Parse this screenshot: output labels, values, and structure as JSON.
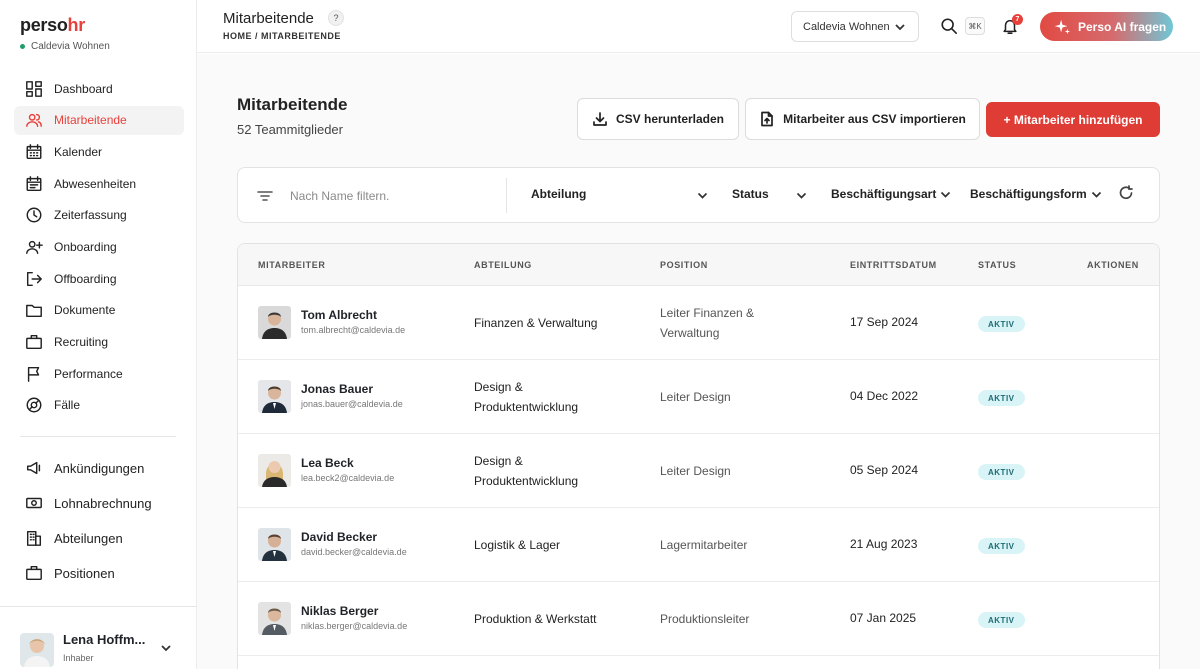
{
  "brand": {
    "name_part1": "perso",
    "name_part2": "hr",
    "company": "Caldevia Wohnen"
  },
  "sidebar": {
    "items": [
      {
        "label": "Dashboard",
        "icon": "dashboard-icon"
      },
      {
        "label": "Mitarbeitende",
        "icon": "users-icon",
        "active": true
      },
      {
        "label": "Kalender",
        "icon": "calendar-icon"
      },
      {
        "label": "Abwesenheiten",
        "icon": "absence-icon"
      },
      {
        "label": "Zeiterfassung",
        "icon": "clock-icon"
      },
      {
        "label": "Onboarding",
        "icon": "user-plus-icon"
      },
      {
        "label": "Offboarding",
        "icon": "logout-icon"
      },
      {
        "label": "Dokumente",
        "icon": "folder-icon"
      },
      {
        "label": "Recruiting",
        "icon": "briefcase-icon"
      },
      {
        "label": "Performance",
        "icon": "flag-icon"
      },
      {
        "label": "Fälle",
        "icon": "lifebuoy-icon"
      }
    ],
    "secondary": [
      {
        "label": "Ankündigungen",
        "icon": "megaphone-icon"
      },
      {
        "label": "Lohnabrechnung",
        "icon": "money-icon"
      },
      {
        "label": "Abteilungen",
        "icon": "building-icon"
      },
      {
        "label": "Positionen",
        "icon": "briefcase-icon"
      }
    ],
    "profile": {
      "name": "Lena Hoffm...",
      "role": "Inhaber"
    }
  },
  "topbar": {
    "title": "Mitarbeitende",
    "help": "?",
    "breadcrumb": "HOME / MITARBEITENDE",
    "company_select": "Caldevia Wohnen",
    "shortcut": "⌘K",
    "notifications": "7",
    "ai_button": "Perso AI fragen"
  },
  "main": {
    "title": "Mitarbeitende",
    "subtitle": "52 Teammitglieder",
    "csv_download": "CSV herunterladen",
    "csv_import": "Mitarbeiter aus CSV importieren",
    "add_employee": "+ Mitarbeiter hinzufügen"
  },
  "filters": {
    "placeholder": "Nach Name filtern.",
    "department": "Abteilung",
    "status": "Status",
    "employment_type": "Beschäftigungsart",
    "employment_form": "Beschäftigungsform"
  },
  "table": {
    "headers": [
      "MITARBEITER",
      "ABTEILUNG",
      "POSITION",
      "EINTRITTSDATUM",
      "STATUS",
      "AKTIONEN"
    ],
    "rows": [
      {
        "name": "Tom Albrecht",
        "email": "tom.albrecht@caldevia.de",
        "dept1": "Finanzen & Verwaltung",
        "dept2": "",
        "pos1": "Leiter Finanzen &",
        "pos2": "Verwaltung",
        "date": "17 Sep 2024",
        "status": "AKTIV"
      },
      {
        "name": "Jonas Bauer",
        "email": "jonas.bauer@caldevia.de",
        "dept1": "Design &",
        "dept2": "Produktentwicklung",
        "pos1": "Leiter Design",
        "pos2": "",
        "date": "04 Dec 2022",
        "status": "AKTIV"
      },
      {
        "name": "Lea Beck",
        "email": "lea.beck2@caldevia.de",
        "dept1": "Design &",
        "dept2": "Produktentwicklung",
        "pos1": "Leiter Design",
        "pos2": "",
        "date": "05 Sep 2024",
        "status": "AKTIV"
      },
      {
        "name": "David Becker",
        "email": "david.becker@caldevia.de",
        "dept1": "Logistik & Lager",
        "dept2": "",
        "pos1": "Lagermitarbeiter",
        "pos2": "",
        "date": "21 Aug 2023",
        "status": "AKTIV"
      },
      {
        "name": "Niklas Berger",
        "email": "niklas.berger@caldevia.de",
        "dept1": "Produktion & Werkstatt",
        "dept2": "",
        "pos1": "Produktionsleiter",
        "pos2": "",
        "date": "07 Jan 2025",
        "status": "AKTIV"
      }
    ]
  },
  "colors": {
    "accent": "#e8413b",
    "status_bg": "#d9f4f7",
    "status_text": "#1d6b74"
  }
}
